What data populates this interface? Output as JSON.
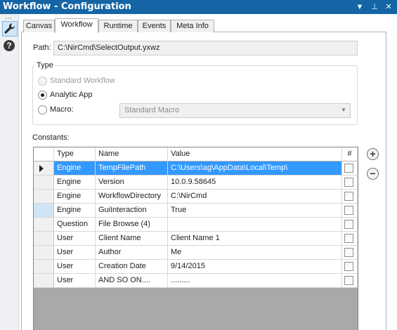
{
  "window": {
    "title": "Workflow - Configuration"
  },
  "title_controls": [
    "▼",
    "⊥",
    "✕"
  ],
  "rail": {
    "dots": "⋯",
    "tool_icon": "wrench-icon",
    "help_glyph": "?"
  },
  "tabs": [
    "Canvas",
    "Workflow",
    "Runtime",
    "Events",
    "Meta Info"
  ],
  "active_tab": "Workflow",
  "path": {
    "label": "Path:",
    "value": "C:\\NirCmd\\SelectOutput.yxwz"
  },
  "type_group": {
    "title": "Type",
    "standard": "Standard Workflow",
    "analytic": "Analytic App",
    "macro": "Macro:",
    "macro_select": "Standard Macro"
  },
  "constants": {
    "label": "Constants:",
    "headers": {
      "type": "Type",
      "name": "Name",
      "value": "Value",
      "hash": "#"
    },
    "rows": [
      {
        "type": "Engine",
        "name": "TempFilePath",
        "value": "C:\\Users\\ag\\AppData\\Local\\Temp\\"
      },
      {
        "type": "Engine",
        "name": "Version",
        "value": "10.0.9.58645"
      },
      {
        "type": "Engine",
        "name": "WorkflowDirectory",
        "value": "C:\\NirCmd"
      },
      {
        "type": "Engine",
        "name": "GuiInteraction",
        "value": "True"
      },
      {
        "type": "Question",
        "name": "File Browse (4)",
        "value": ""
      },
      {
        "type": "User",
        "name": "Client Name",
        "value": "Client Name 1"
      },
      {
        "type": "User",
        "name": "Author",
        "value": "Me"
      },
      {
        "type": "User",
        "name": "Creation Date",
        "value": "9/14/2015"
      },
      {
        "type": "User",
        "name": "AND SO ON....",
        "value": "........."
      }
    ],
    "add_glyph": "+",
    "remove_glyph": "−"
  },
  "colors": {
    "titlebar": "#1565a6",
    "selection": "#3399ff",
    "grid_empty": "#a9a9a9"
  }
}
